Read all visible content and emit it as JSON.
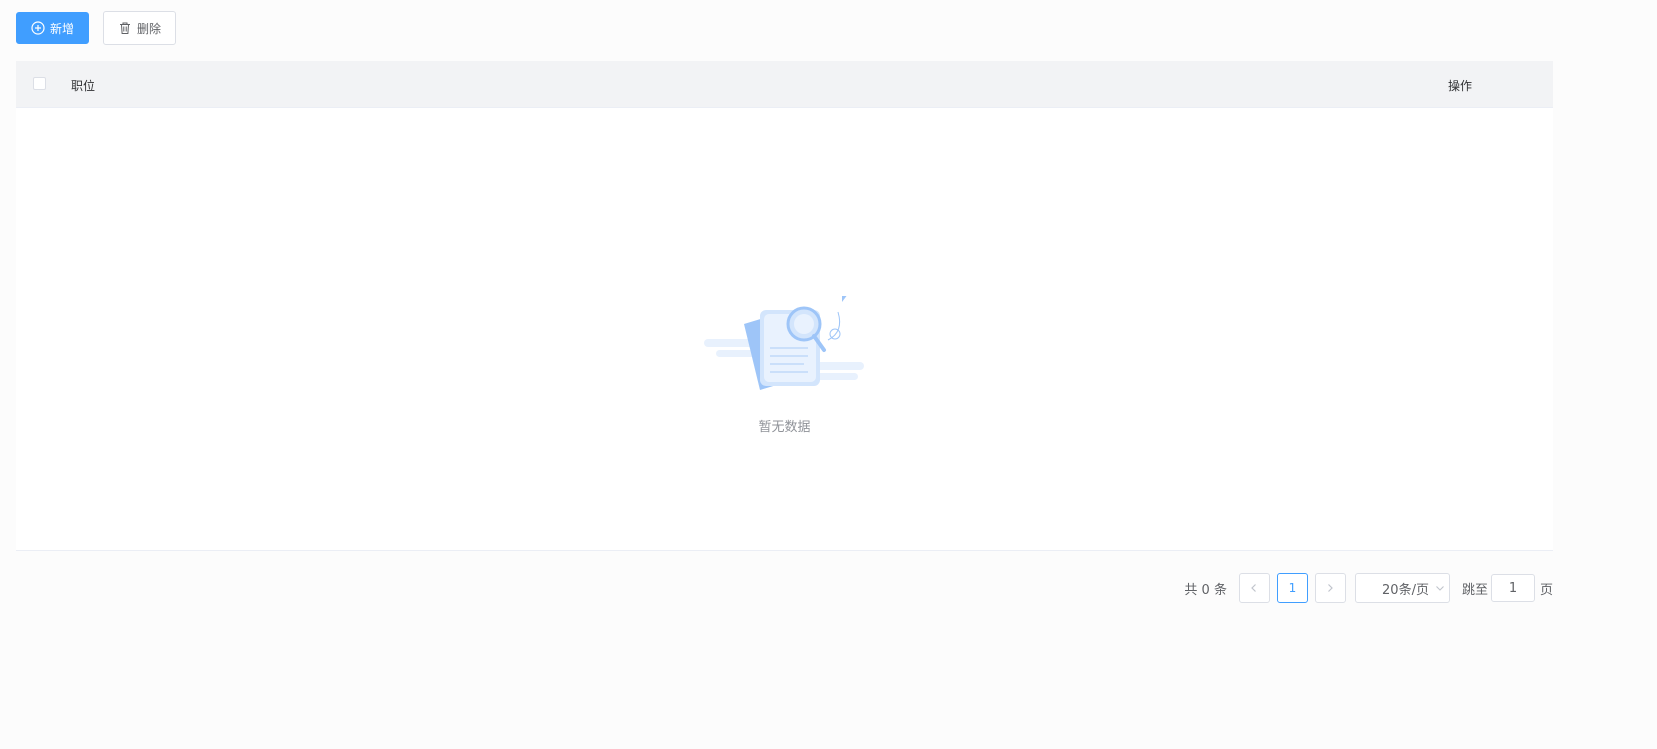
{
  "toolbar": {
    "add_label": "新增",
    "delete_label": "删除"
  },
  "table": {
    "columns": [
      "职位",
      "操作"
    ],
    "empty_text": "暂无数据"
  },
  "pagination": {
    "total_text": "共 0 条",
    "current_page": "1",
    "page_size_label": "20条/页",
    "jump_label": "跳至",
    "jump_value": "1",
    "page_suffix": "页"
  },
  "colors": {
    "primary": "#409eff",
    "header_bg": "#f2f3f5"
  }
}
